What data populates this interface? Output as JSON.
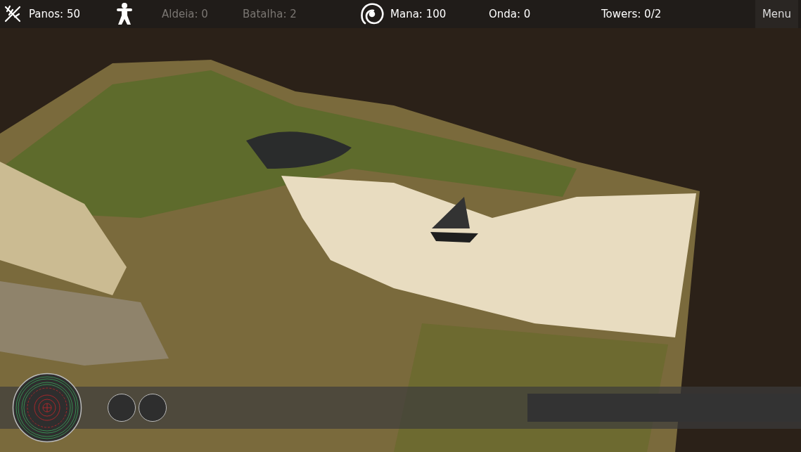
{
  "hud": [
    {
      "kind": "sticks"
    },
    {
      "kind": "text",
      "label": "Panos: 50",
      "disabled": false
    },
    {
      "kind": "figure"
    },
    {
      "kind": "text",
      "label": "Aldeia: 0",
      "disabled": true
    },
    {
      "kind": "text",
      "label": "Batalha: 2",
      "disabled": true
    },
    {
      "kind": "spiral"
    },
    {
      "kind": "text",
      "label": "Mana: 100",
      "disabled": false
    },
    {
      "kind": "text",
      "label": "Onda: 0",
      "disabled": false
    },
    {
      "kind": "text",
      "label": "Towers: 0/2",
      "disabled": false
    },
    {
      "kind": "menu",
      "label": "Menu",
      "disabled": false
    }
  ],
  "bottom_bar": {
    "buttons": [
      {
        "kind": "round"
      },
      {
        "kind": "round"
      }
    ]
  }
}
